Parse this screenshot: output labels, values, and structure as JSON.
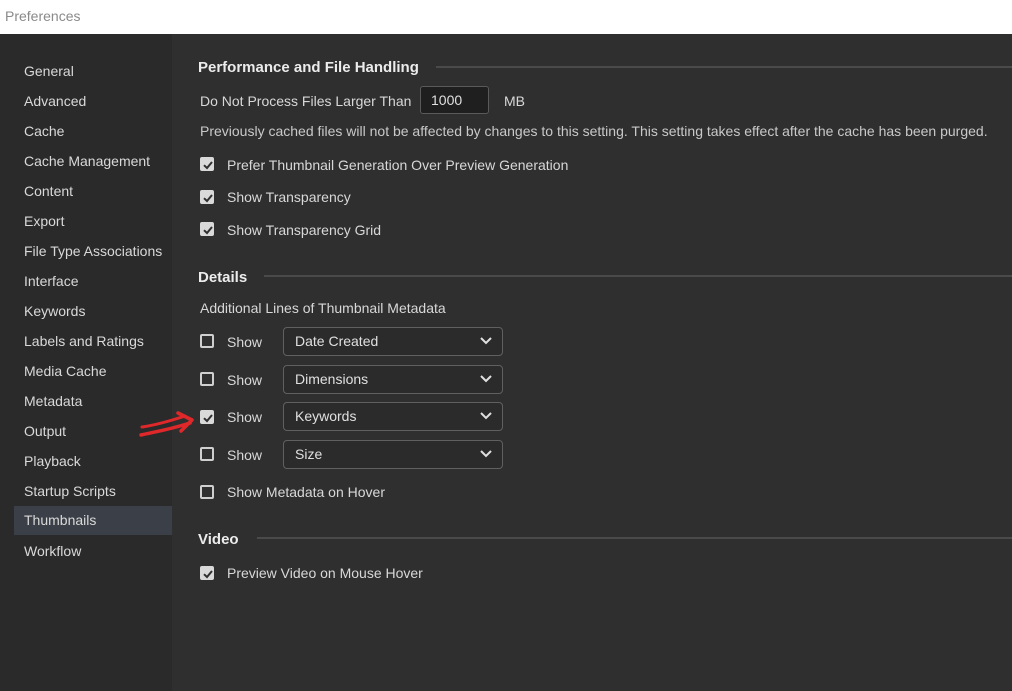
{
  "window": {
    "title": "Preferences"
  },
  "sidebar": {
    "items": [
      {
        "label": "General"
      },
      {
        "label": "Advanced"
      },
      {
        "label": "Cache"
      },
      {
        "label": "Cache Management"
      },
      {
        "label": "Content"
      },
      {
        "label": "Export"
      },
      {
        "label": "File Type Associations"
      },
      {
        "label": "Interface"
      },
      {
        "label": "Keywords"
      },
      {
        "label": "Labels and Ratings"
      },
      {
        "label": "Media Cache"
      },
      {
        "label": "Metadata"
      },
      {
        "label": "Output"
      },
      {
        "label": "Playback"
      },
      {
        "label": "Startup Scripts"
      },
      {
        "label": "Thumbnails"
      },
      {
        "label": "Workflow"
      }
    ],
    "active": "Thumbnails"
  },
  "performance": {
    "title": "Performance and File Handling",
    "max_size_label": "Do Not Process Files Larger Than",
    "max_size_value": "1000",
    "max_size_unit": "MB",
    "note": "Previously cached files will not be affected by changes to this setting. This setting takes effect after the cache has been purged.",
    "options": [
      {
        "label": "Prefer Thumbnail Generation Over Preview Generation",
        "checked": true
      },
      {
        "label": "Show Transparency",
        "checked": true
      },
      {
        "label": "Show Transparency Grid",
        "checked": true
      }
    ]
  },
  "details": {
    "title": "Details",
    "subtitle": "Additional Lines of Thumbnail Metadata",
    "show_label": "Show",
    "lines": [
      {
        "checked": false,
        "value": "Date Created"
      },
      {
        "checked": false,
        "value": "Dimensions"
      },
      {
        "checked": true,
        "value": "Keywords"
      },
      {
        "checked": false,
        "value": "Size"
      }
    ],
    "hover_option": {
      "label": "Show Metadata on Hover",
      "checked": false
    }
  },
  "video": {
    "title": "Video",
    "options": [
      {
        "label": "Preview Video on Mouse Hover",
        "checked": true
      }
    ]
  },
  "colors": {
    "background": "#2f2f2f",
    "sidebar": "#2a2a2a",
    "sidebar_active": "#3b4048",
    "annotation_arrow": "#e0282a"
  },
  "icons": {
    "checkbox_check": "check-icon",
    "dropdown": "chevron-down-icon",
    "annotation": "red-arrow-annotation-icon"
  }
}
